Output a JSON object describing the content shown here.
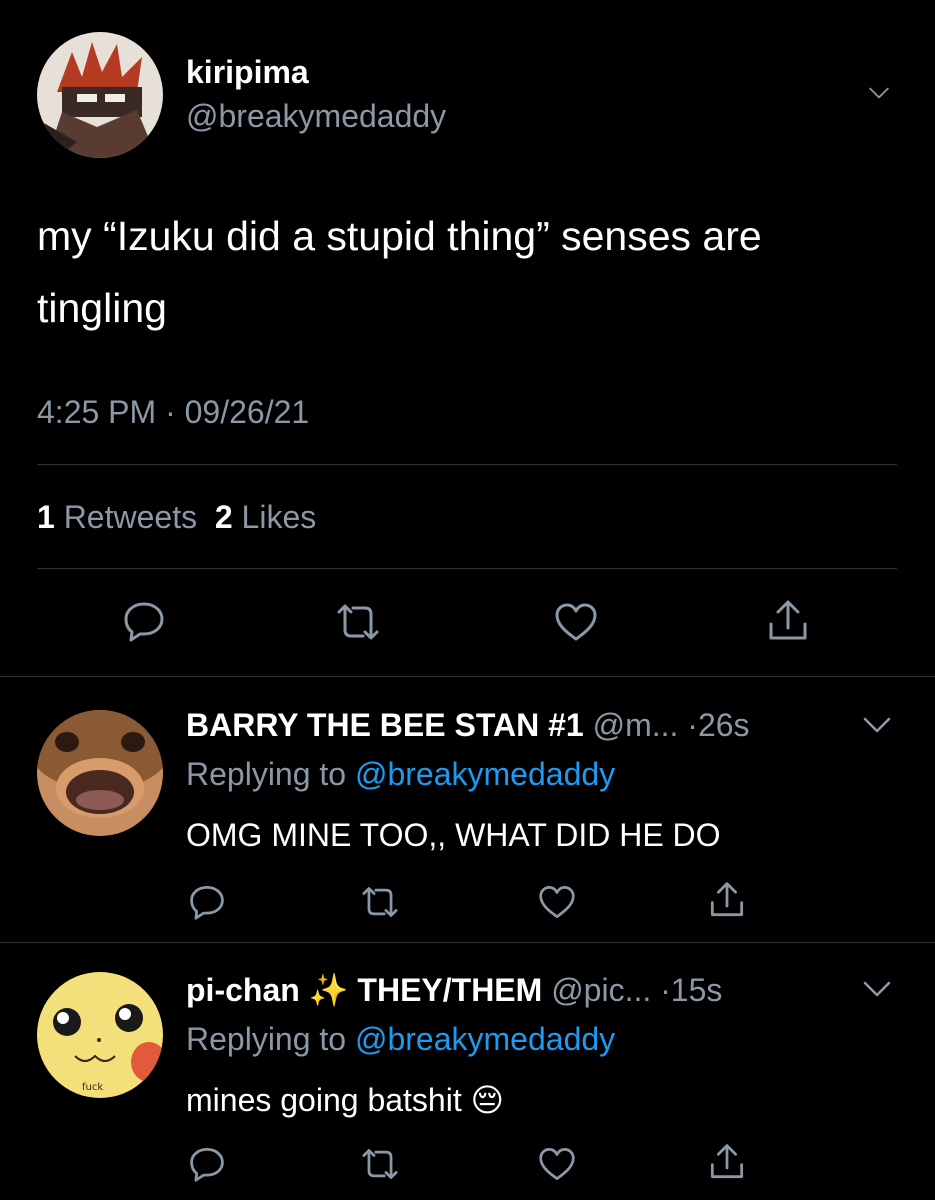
{
  "tweet": {
    "author_name": "kiripima",
    "author_handle": "@breakymedaddy",
    "text": "my “Izuku did a stupid thing” senses are tingling",
    "time": "4:25 PM",
    "dot": "·",
    "date": "09/26/21",
    "retweets_count": "1",
    "retweets_label": "Retweets",
    "likes_count": "2",
    "likes_label": "Likes"
  },
  "replies": [
    {
      "name": "BARRY THE BEE STAN #1",
      "handle": "@m...",
      "time": "·26s",
      "replying_prefix": "Replying to",
      "replying_handle": "@breakymedaddy",
      "text": "OMG MINE TOO,, WHAT DID HE DO"
    },
    {
      "name_part1": "pi-chan",
      "name_emoji": "✨",
      "name_part2": "THEY/THEM",
      "handle": "@pic...",
      "time": "·15s",
      "replying_prefix": "Replying to",
      "replying_handle": "@breakymedaddy",
      "text": "mines going batshit",
      "text_emoji": "😔",
      "avatar_text": "fuck"
    }
  ],
  "icons": {
    "reply": "reply-icon",
    "retweet": "retweet-icon",
    "like": "heart-icon",
    "share": "share-icon",
    "more": "chevron-down-icon"
  },
  "colors": {
    "background": "#000000",
    "text": "#ffffff",
    "muted": "#8b98a5",
    "link": "#1d9bf0",
    "divider": "#2f3336"
  }
}
